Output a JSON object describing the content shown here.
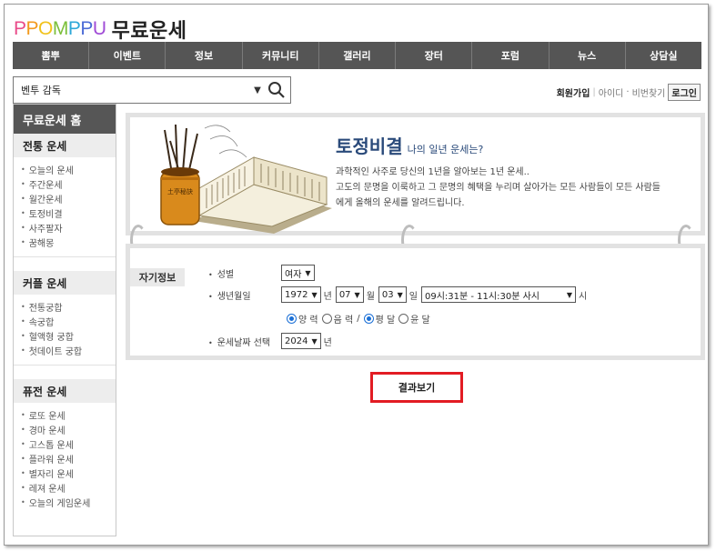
{
  "logo": {
    "brand_letters": [
      {
        "ch": "P",
        "color": "#e94b8a"
      },
      {
        "ch": "P",
        "color": "#f39a1f"
      },
      {
        "ch": "O",
        "color": "#f1c21b"
      },
      {
        "ch": "M",
        "color": "#7bbf3a"
      },
      {
        "ch": "P",
        "color": "#2fa8d8"
      },
      {
        "ch": "P",
        "color": "#4b6bd6"
      },
      {
        "ch": "U",
        "color": "#a04bd6"
      }
    ],
    "title": "무료운세"
  },
  "gnb": [
    "뽐뿌",
    "이벤트",
    "정보",
    "커뮤니티",
    "갤러리",
    "장터",
    "포럼",
    "뉴스",
    "상담실"
  ],
  "search": {
    "value": "벤투 감독"
  },
  "member": {
    "join": "회원가입",
    "find_id": "아이디",
    "find_pw": "비번찾기",
    "login": "로그인"
  },
  "sidebar": {
    "home": "무료운세 홈",
    "groups": [
      {
        "title": "전통 운세",
        "items": [
          "오늘의 운세",
          "주간운세",
          "월간운세",
          "토정비결",
          "사주팔자",
          "꿈해몽"
        ]
      },
      {
        "title": "커플 운세",
        "items": [
          "전통궁합",
          "속궁합",
          "혈액형 궁합",
          "첫데이트 궁합"
        ]
      },
      {
        "title": "퓨전 운세",
        "items": [
          "로또 운세",
          "경마 운세",
          "고스톱 운세",
          "플라워 운세",
          "별자리 운세",
          "레져 운세",
          "오늘의 게임운세"
        ]
      }
    ]
  },
  "banner": {
    "title": "토정비결",
    "subtitle": "나의 일년 운세는?",
    "lines": [
      "과학적인 사주로 당신의 1년을 알아보는 1년 운세..",
      "고도의 문명을 이룩하고 그 문명의 혜택을 누리며 살아가는 모든 사람들이 모든 사람들",
      "에게 올해의 운세를 알려드립니다."
    ],
    "book_text": "土亭秘訣"
  },
  "form": {
    "tag": "자기정보",
    "gender": {
      "label": "성별",
      "value": "여자"
    },
    "birth": {
      "label": "생년월일",
      "year": "1972",
      "year_unit": "년",
      "month": "07",
      "month_unit": "월",
      "day": "03",
      "day_unit": "일",
      "time": "09시:31분 - 11시:30분 사시",
      "time_unit": "시"
    },
    "calendar": {
      "solar": "양 력",
      "lunar": "음 력",
      "slash": "/",
      "normal": "평 달",
      "leap": "윤 달"
    },
    "target": {
      "label": "운세날짜 선택",
      "year": "2024",
      "unit": "년"
    }
  },
  "result_button": "결과보기",
  "colors": {
    "nav_bg": "#555555",
    "title_blue": "#2a4a7a",
    "button_border": "#e21c23",
    "radio_blue": "#1a6fd6"
  }
}
